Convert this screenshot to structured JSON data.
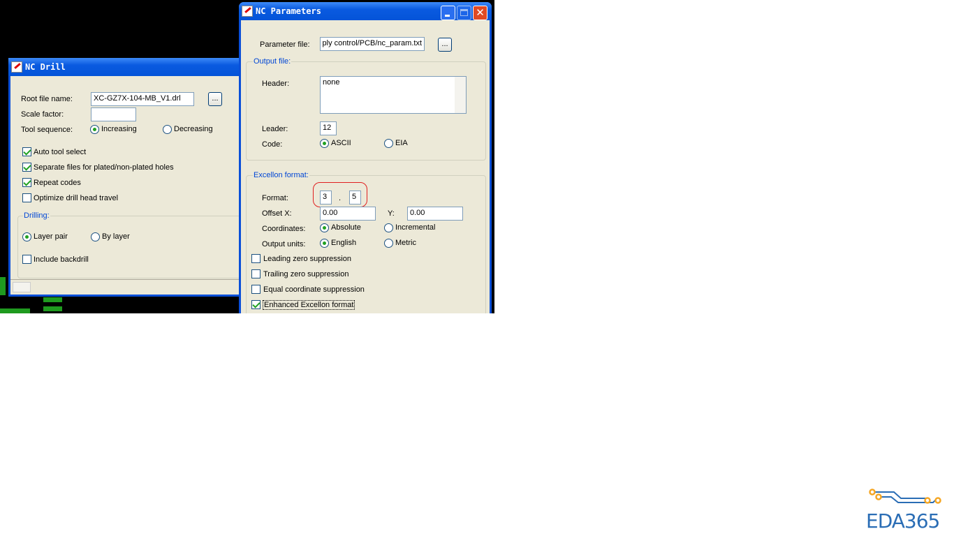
{
  "nc_drill": {
    "title": "NC Drill",
    "root_file_label": "Root file name:",
    "root_file_value": "XC-GZ7X-104-MB_V1.drl",
    "browse": "...",
    "scale_label": "Scale factor:",
    "scale_value": "",
    "tool_seq_label": "Tool sequence:",
    "increasing": "Increasing",
    "decreasing": "Decreasing",
    "auto_tool": "Auto tool select",
    "separate": "Separate files for plated/non-plated holes",
    "repeat": "Repeat codes",
    "optimize": "Optimize drill head travel",
    "drilling_group": "Drilling:",
    "layer_pair": "Layer pair",
    "by_layer": "By layer",
    "backdrill": "Include backdrill"
  },
  "nc_params": {
    "title": "NC Parameters",
    "param_file_label": "Parameter file:",
    "param_file_value": "ply control/PCB/nc_param.txt",
    "browse": "...",
    "output_group": "Output file:",
    "header_label": "Header:",
    "header_value": "none",
    "leader_label": "Leader:",
    "leader_value": "12",
    "code_label": "Code:",
    "ascii": "ASCII",
    "eia": "EIA",
    "excellon_group": "Excellon format:",
    "format_label": "Format:",
    "format_int": "3",
    "format_dot": ".",
    "format_dec": "5",
    "offset_x_label": "Offset X:",
    "offset_x": "0.00",
    "y_label": "Y:",
    "offset_y": "0.00",
    "coords_label": "Coordinates:",
    "absolute": "Absolute",
    "incremental": "Incremental",
    "units_label": "Output units:",
    "english": "English",
    "metric": "Metric",
    "leading": "Leading zero suppression",
    "trailing": "Trailing zero suppression",
    "equal": "Equal coordinate suppression",
    "enhanced": "Enhanced Excellon format"
  },
  "logo": {
    "text": "EDA365"
  },
  "colors": {
    "accent": "#0a4fd8",
    "highlight": "#e02020",
    "logo_blue": "#2a6db5",
    "logo_orange": "#f5a623"
  }
}
